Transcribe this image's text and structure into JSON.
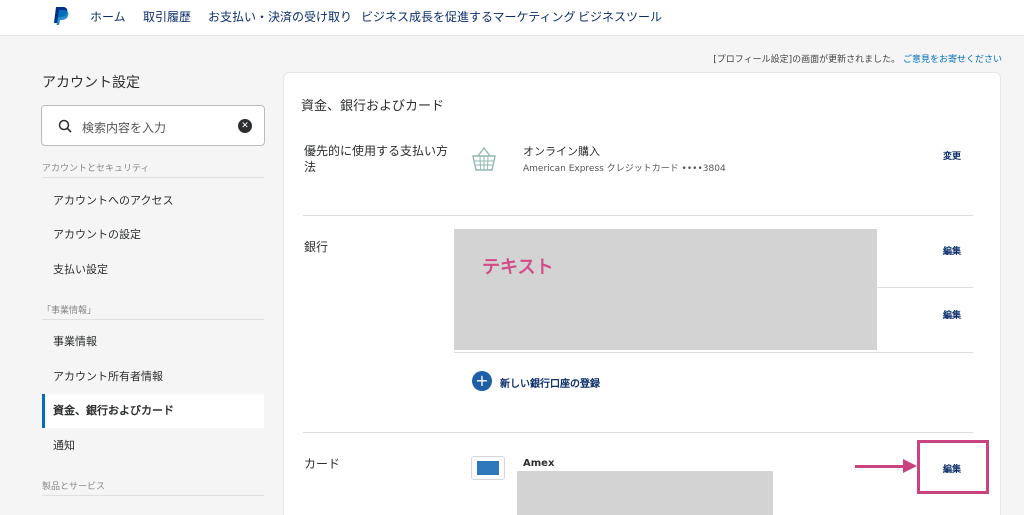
{
  "nav": {
    "items": [
      "ホーム",
      "取引履歴",
      "お支払い・決済の受け取り",
      "ビジネス成長を促進するマーケティング",
      "ビジネスツール"
    ]
  },
  "notice": {
    "text": "[プロフィール設定]の画面が更新されました。",
    "link": "ご意見をお寄せください"
  },
  "sidebar": {
    "title": "アカウント設定",
    "search_placeholder": "検索内容を入力",
    "sections": [
      {
        "heading": "アカウントとセキュリティ",
        "items": [
          "アカウントへのアクセス",
          "アカウントの設定",
          "支払い設定"
        ]
      },
      {
        "heading": "「事業情報」",
        "items": [
          "事業情報",
          "アカウント所有者情報",
          "資金、銀行およびカード",
          "通知"
        ]
      },
      {
        "heading": "製品とサービス",
        "items": []
      }
    ],
    "active_item": "資金、銀行およびカード"
  },
  "main": {
    "title": "資金、銀行およびカード",
    "preferred": {
      "label": "優先的に使用する支払い方法",
      "method_title": "オンライン購入",
      "method_detail": "American Express クレジットカード ••••3804",
      "action": "変更"
    },
    "bank": {
      "label": "銀行",
      "overlay_text": "テキスト",
      "edit_1": "編集",
      "edit_2": "編集",
      "add_label": "新しい銀行口座の登録"
    },
    "card": {
      "label": "カード",
      "name": "Amex",
      "edit": "編集"
    }
  },
  "colors": {
    "accent": "#0070ba",
    "link": "#0c2f6b",
    "annotation": "#c8437f",
    "redaction": "#d3d3d3"
  },
  "icons": [
    "paypal-logo-icon",
    "search-icon",
    "clear-icon",
    "basket-icon",
    "plus-icon",
    "amex-card-icon",
    "arrow-annotation-icon"
  ]
}
